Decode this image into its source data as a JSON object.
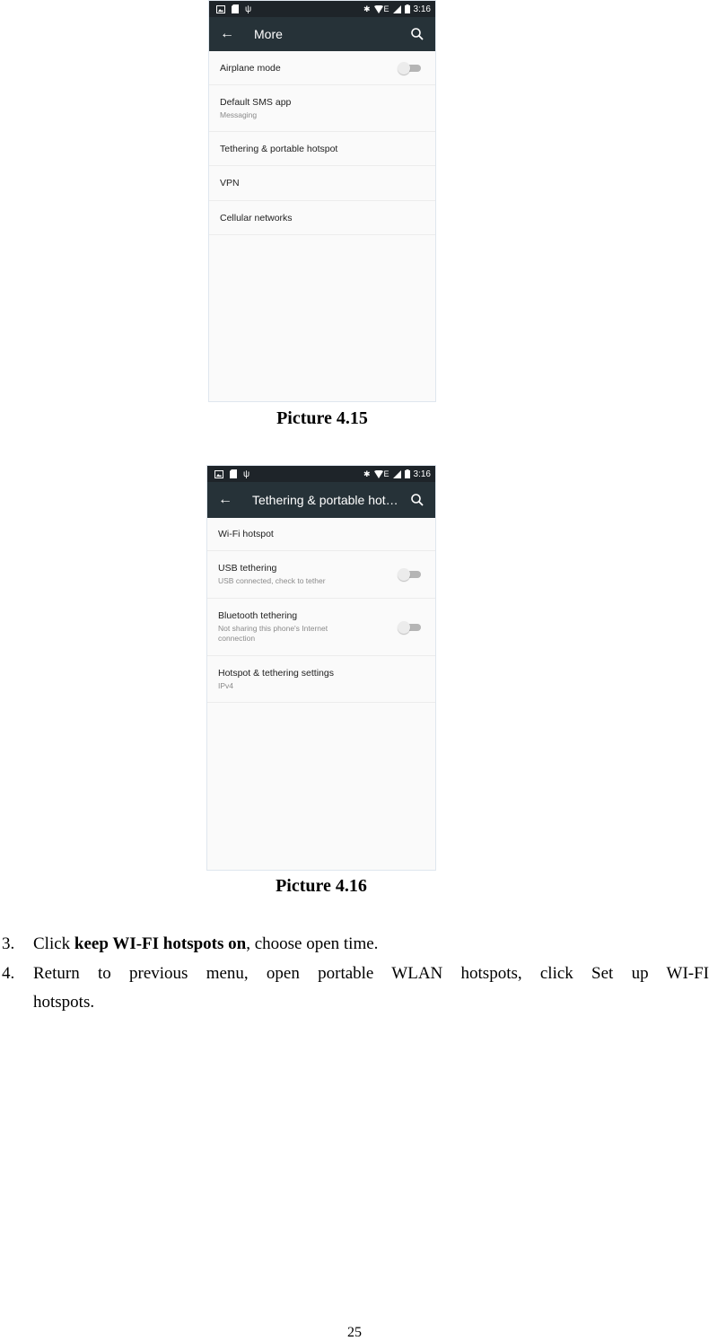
{
  "status_bar": {
    "time": "3:16",
    "network": "E"
  },
  "screen1": {
    "title": "More",
    "items": [
      {
        "title": "Airplane mode",
        "subtitle": "",
        "toggle": "off"
      },
      {
        "title": "Default SMS app",
        "subtitle": "Messaging"
      },
      {
        "title": "Tethering & portable hotspot",
        "subtitle": ""
      },
      {
        "title": "VPN",
        "subtitle": ""
      },
      {
        "title": "Cellular networks",
        "subtitle": ""
      }
    ],
    "caption": "Picture 4.15"
  },
  "screen2": {
    "title": "Tethering & portable hot…",
    "items": [
      {
        "title": "Wi-Fi hotspot",
        "subtitle": ""
      },
      {
        "title": "USB tethering",
        "subtitle": "USB connected, check to tether",
        "toggle": "off"
      },
      {
        "title": "Bluetooth tethering",
        "subtitle": "Not sharing this phone's Internet connection",
        "toggle": "off"
      },
      {
        "title": "Hotspot & tethering settings",
        "subtitle": "IPv4"
      }
    ],
    "caption": "Picture 4.16"
  },
  "steps": [
    {
      "number": "3.",
      "prefix": "Click ",
      "bold": "keep WI-FI hotspots on",
      "suffix": ", choose open time."
    },
    {
      "number": "4.",
      "line1": "Return to previous menu, open portable WLAN hotspots, click Set up WI-FI",
      "line2": "hotspots."
    }
  ],
  "page_number": "25"
}
